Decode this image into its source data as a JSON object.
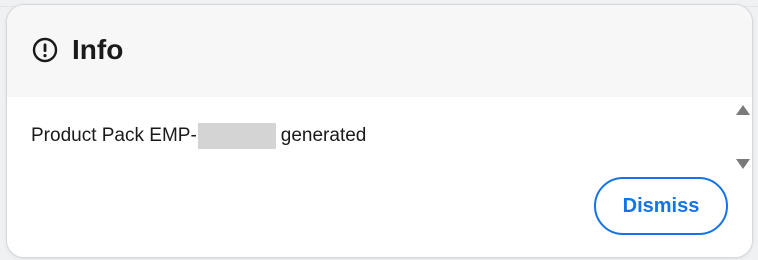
{
  "dialog": {
    "title": "Info",
    "icon": "info-icon",
    "message_prefix": "Product Pack EMP-",
    "message_suffix": "generated",
    "dismiss_label": "Dismiss"
  },
  "colors": {
    "accent": "#1473e6",
    "header_bg": "#f7f7f7",
    "redaction": "#d4d4d4"
  }
}
